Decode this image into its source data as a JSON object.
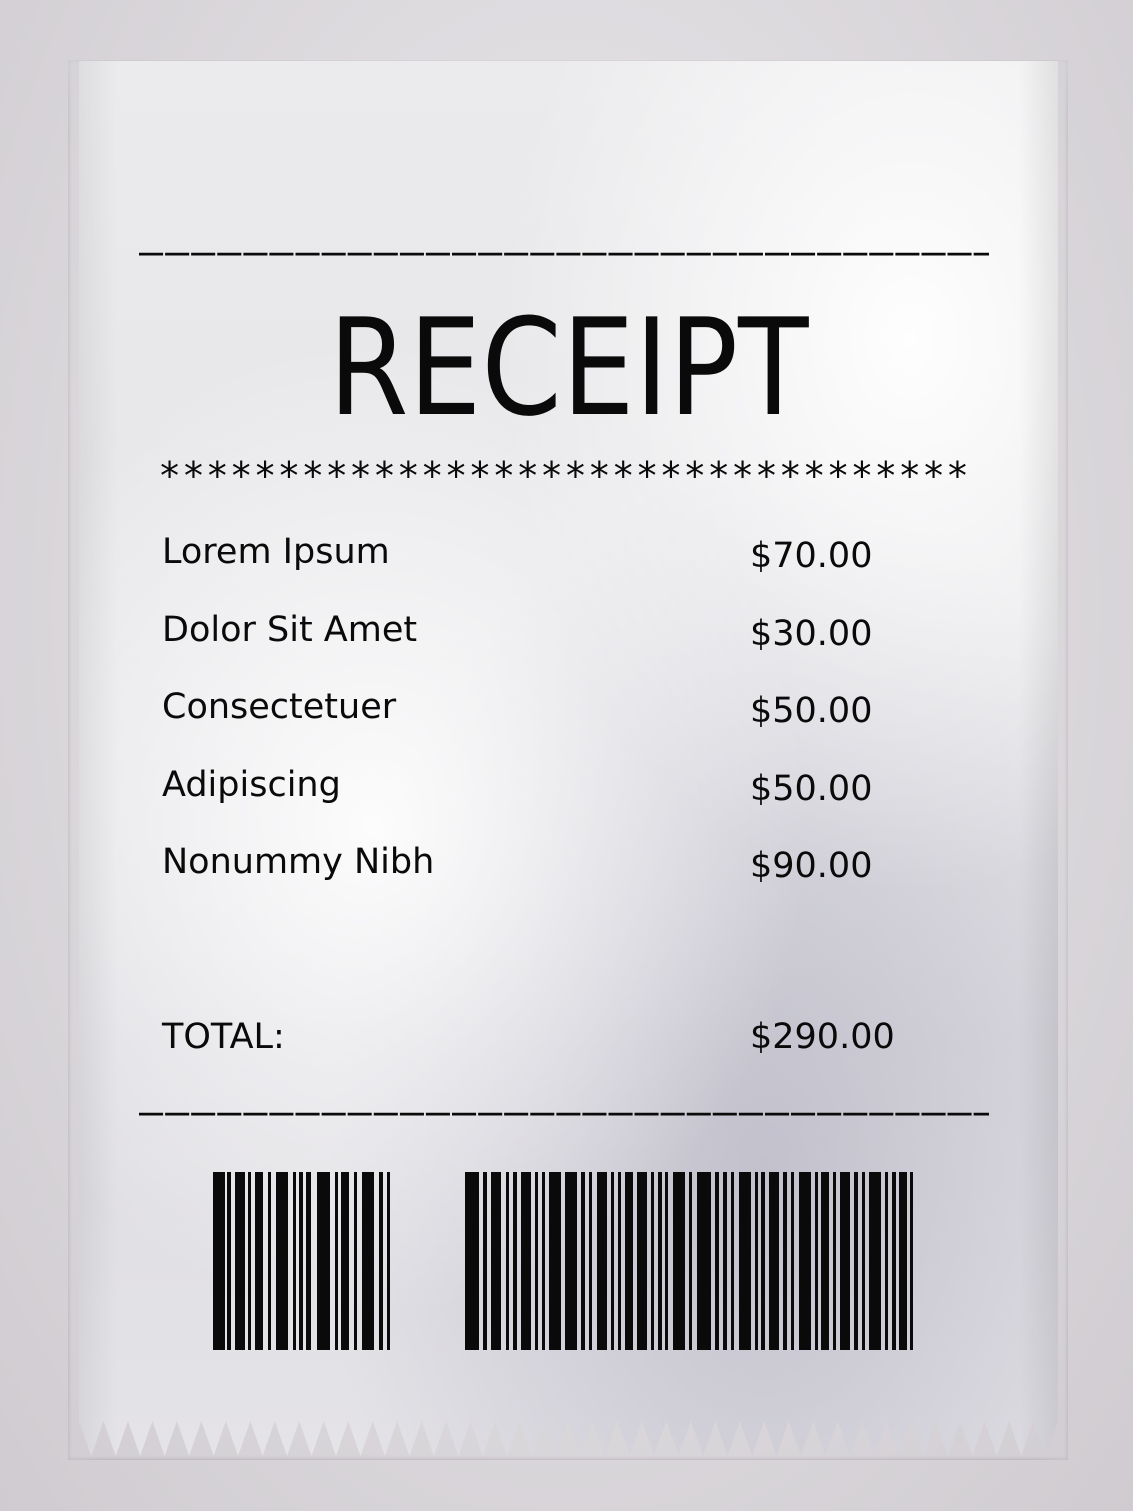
{
  "receipt": {
    "top_rule": "––––––––––––––––––––––––––––––––––––",
    "title": "RECEIPT",
    "stars": "**********************************",
    "items": [
      {
        "name": "Lorem Ipsum",
        "price": "$70.00"
      },
      {
        "name": "Dolor Sit Amet",
        "price": "$30.00"
      },
      {
        "name": "Consectetuer",
        "price": "$50.00"
      },
      {
        "name": "Adipiscing",
        "price": "$50.00"
      },
      {
        "name": "Nonummy Nibh",
        "price": "$90.00"
      }
    ],
    "total_label": "TOTAL:",
    "total_value": "$290.00",
    "bottom_rule": "––––––––––––––––––––––––––––––––––––"
  },
  "colors": {
    "ink": "#0a0a0a",
    "paper": "#e8e8eb",
    "background": "#d6d3d8"
  },
  "icons": {
    "barcode": "barcode-icon"
  }
}
